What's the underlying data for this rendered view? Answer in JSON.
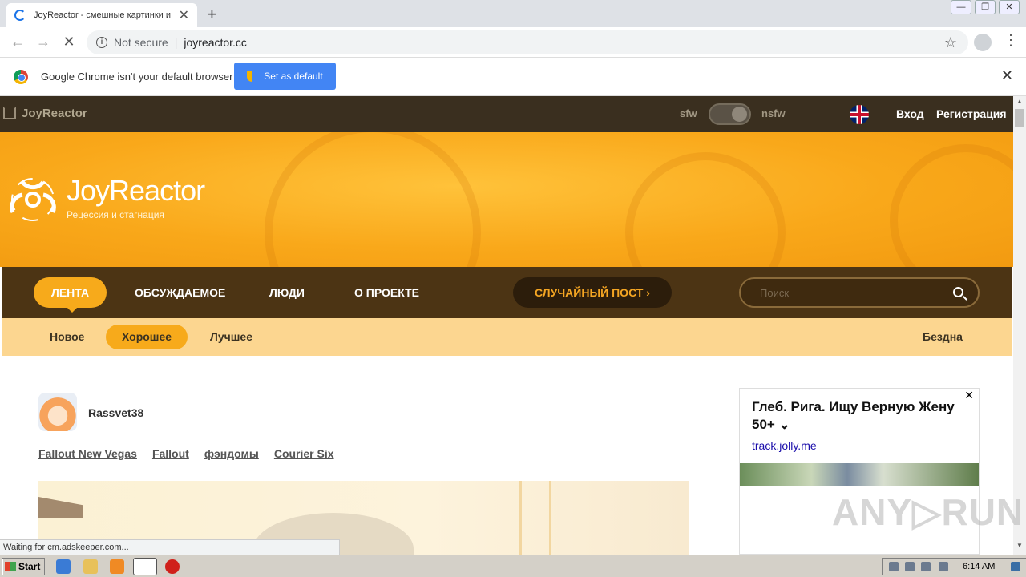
{
  "browser": {
    "tab_title": "JoyReactor - смешные картинки и",
    "tab_close": "✕",
    "new_tab": "+",
    "back": "←",
    "forward": "→",
    "reload": "✕",
    "not_secure": "Not secure",
    "separator": "|",
    "url": "joyreactor.cc",
    "bookmark": "☆",
    "menu": "⋮",
    "window_min": "—",
    "window_restore": "❐",
    "window_close": "✕",
    "infobar_message": "Google Chrome isn't your default browser",
    "set_default_label": "Set as default",
    "infobar_close": "✕",
    "status_text": "Waiting for cm.adskeeper.com..."
  },
  "site": {
    "brand": "JoyReactor",
    "sfw_label": "sfw",
    "nsfw_label": "nsfw",
    "login": "Вход",
    "register": "Регистрация",
    "logo_text": "JoyReactor",
    "logo_subtitle": "Рецессия и стагнация",
    "nav": [
      "ЛЕНТА",
      "ОБСУЖДАЕМОЕ",
      "ЛЮДИ",
      "О ПРОЕКТЕ"
    ],
    "random_post": "СЛУЧАЙНЫЙ ПОСТ  ›",
    "search_placeholder": "Поиск",
    "subnav": [
      "Новое",
      "Хорошее",
      "Лучшее"
    ],
    "abyss": "Бездна"
  },
  "post": {
    "username": "Rassvet38",
    "tags": [
      "Fallout New Vegas",
      "Fallout",
      "фэндомы",
      "Courier Six"
    ]
  },
  "ad": {
    "close": "✕",
    "title": "Глеб. Рига. Ищу Верную Жену 50+ ⌄",
    "domain": "track.jolly.me"
  },
  "watermark": "ANY▷RUN",
  "taskbar": {
    "start": "Start",
    "clock": "6:14 AM"
  },
  "icons": [
    "spinner-icon",
    "home-icon",
    "uk-flag-icon",
    "search-icon",
    "hazard-logo-icon",
    "shield-icon",
    "chrome-icon",
    "info-icon",
    "star-icon",
    "profile-icon"
  ],
  "colors": {
    "topnav": "#3a2f1f",
    "banner": "#f9a81a",
    "mainnav": "#4c3414",
    "accent": "#f7aa1b",
    "subnav": "#fcd690",
    "chrome_blue": "#4285f4"
  }
}
